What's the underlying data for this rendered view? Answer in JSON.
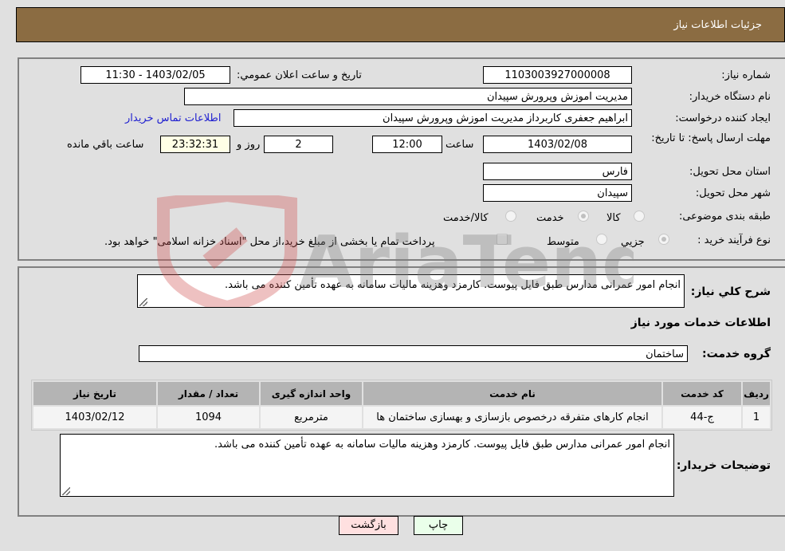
{
  "header": {
    "title": "جزئيات اطلاعات نیاز"
  },
  "details": {
    "need_number": {
      "label": "شماره نیاز:",
      "value": "1103003927000008"
    },
    "announce_datetime": {
      "label": "تاریخ و ساعت اعلان عمومي:",
      "value": "1403/02/05 - 11:30"
    },
    "buyer_org": {
      "label": "نام دستگاه خریدار:",
      "value": "مدیریت اموزش وپرورش سپیدان"
    },
    "requester": {
      "label": "ایجاد کننده درخواست:",
      "value": "ابراهیم جعفری کاربرداز مدیریت اموزش وپرورش سپیدان",
      "contact_link": "اطلاعات تماس خریدار"
    },
    "deadline": {
      "label": "مهلت ارسال پاسخ: تا تاریخ:",
      "date": "1403/02/08",
      "time_label": "ساعت",
      "time": "12:00",
      "days": "2",
      "days_label": "روز و",
      "remaining": "23:32:31",
      "remaining_label": "ساعت باقي مانده"
    },
    "province": {
      "label": "استان محل تحویل:",
      "value": "فارس"
    },
    "city": {
      "label": "شهر محل تحویل:",
      "value": "سپیدان"
    },
    "category": {
      "label": "طبقه بندی موضوعی:",
      "options": [
        {
          "label": "کالا",
          "checked": false
        },
        {
          "label": "خدمت",
          "checked": true
        },
        {
          "label": "کالا/خدمت",
          "checked": false
        }
      ]
    },
    "purchase_type": {
      "label": "نوع فرآیند خرید :",
      "options": [
        {
          "label": "جزيي",
          "checked": true
        },
        {
          "label": "متوسط",
          "checked": false
        }
      ],
      "treasury_checkbox": {
        "label": "پرداخت تمام یا بخشی از مبلغ خرید،از محل \"اسناد خزانه اسلامی\" خواهد بود.",
        "checked": false
      }
    }
  },
  "summary": {
    "label": "شرح كلي نياز:",
    "value": "انجام امور عمرانی مدارس طبق فایل پیوست. کارمزد وهزینه مالیات سامانه به عهده تأمین کننده می باشد."
  },
  "services": {
    "section_title": "اطلاعات خدمات مورد نیاز",
    "group_label": "گروه خدمت:",
    "group_value": "ساختمان",
    "table": {
      "headers": [
        "ردیف",
        "کد خدمت",
        "نام خدمت",
        "واحد اندازه گیری",
        "تعداد / مقدار",
        "تاریخ نیاز"
      ],
      "rows": [
        [
          "1",
          "ج-44",
          "انجام کارهای متفرقه درخصوص بازسازی و بهسازی ساختمان ها",
          "مترمربع",
          "1094",
          "1403/02/12"
        ]
      ]
    }
  },
  "buyer_notes": {
    "label": "توضیحات خریدار:",
    "value": "انجام امور عمرانی مدارس طبق فایل پیوست. کارمزد وهزینه مالیات سامانه به عهده تأمین کننده می باشد."
  },
  "buttons": {
    "print": "چاپ",
    "back": "بازگشت"
  },
  "watermark": {
    "text": "AriaTender.neT"
  },
  "colors": {
    "header_bg": "#8b6c42",
    "print_bg": "#eaffea",
    "back_bg": "#ffe0e0",
    "link": "#2020d0"
  }
}
